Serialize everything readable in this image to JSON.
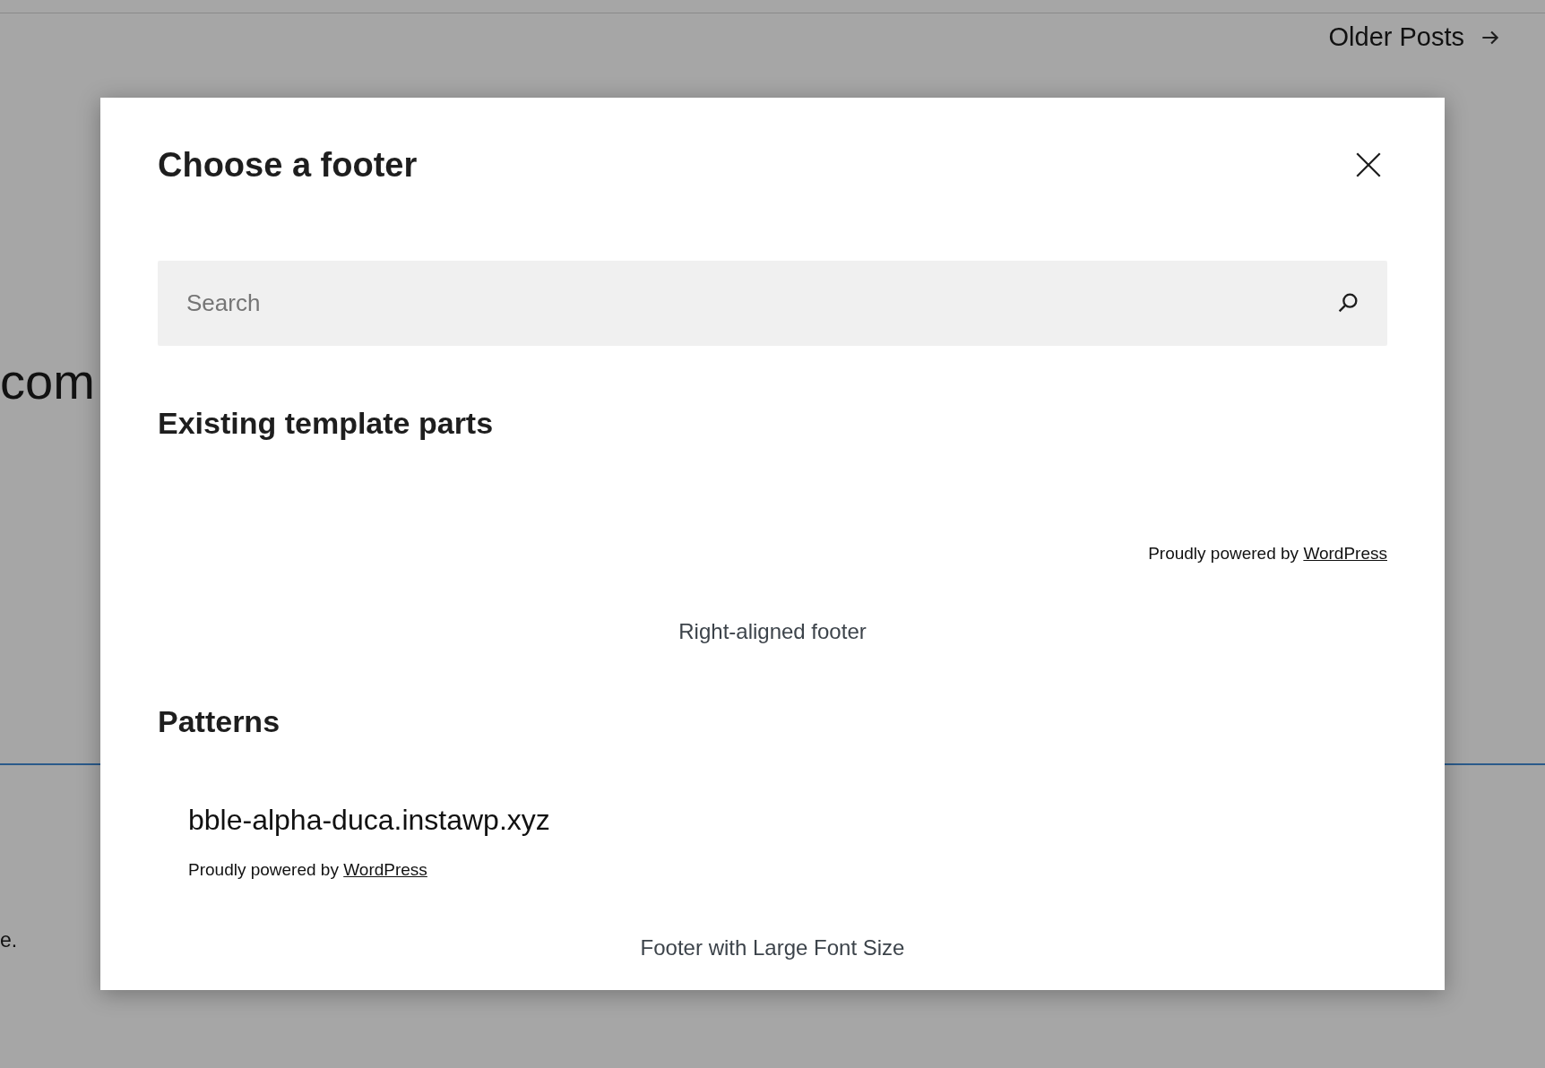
{
  "background": {
    "nav_link": "Older Posts",
    "heading_fragment": "com",
    "text_fragment": "e."
  },
  "modal": {
    "title": "Choose a footer",
    "search": {
      "placeholder": "Search"
    },
    "sections": [
      {
        "title": "Existing template parts",
        "items": [
          {
            "kind": "right",
            "credit": "Proudly powered by ",
            "credit_link": "WordPress",
            "label": "Right-aligned footer"
          }
        ]
      },
      {
        "title": "Patterns",
        "items": [
          {
            "kind": "large",
            "site_title": "bble-alpha-duca.instawp.xyz",
            "credit": "Proudly powered by ",
            "credit_link": "WordPress",
            "label": "Footer with Large Font Size"
          }
        ]
      }
    ]
  }
}
